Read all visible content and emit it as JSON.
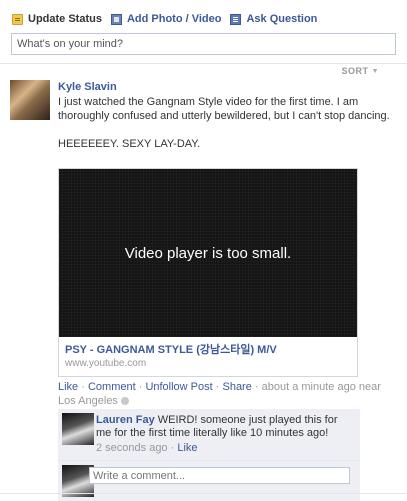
{
  "composer": {
    "tabs": [
      {
        "label": "Update Status",
        "icon": "status-icon"
      },
      {
        "label": "Add Photo / Video",
        "icon": "photo-icon"
      },
      {
        "label": "Ask Question",
        "icon": "question-icon"
      }
    ],
    "placeholder": "What's on your mind?"
  },
  "feed": {
    "sort_label": "SORT"
  },
  "post": {
    "author": "Kyle Slavin",
    "message_1": "I just watched the Gangnam Style video for the first time. I am thoroughly confused and utterly bewildered, but I can't stop dancing.",
    "message_2": "HEEEEEEY. SEXY LAY-DAY.",
    "attachment": {
      "video_message": "Video player is too small.",
      "title": "PSY - GANGNAM STYLE (강남스타일) M/V",
      "domain": "www.youtube.com"
    },
    "actions": {
      "like": "Like",
      "comment": "Comment",
      "unfollow": "Unfollow Post",
      "share": "Share",
      "timestamp": "about a minute ago near Los Angeles"
    },
    "comments": [
      {
        "author": "Lauren Fay",
        "text": "WEIRD! someone just played this for me for the first time literally like 10 minutes ago!",
        "time": "2 seconds ago",
        "like": "Like"
      }
    ],
    "write_comment_placeholder": "Write a comment..."
  },
  "colors": {
    "link": "#3b5998",
    "comments_bg": "#edeff4",
    "meta": "#999999"
  }
}
